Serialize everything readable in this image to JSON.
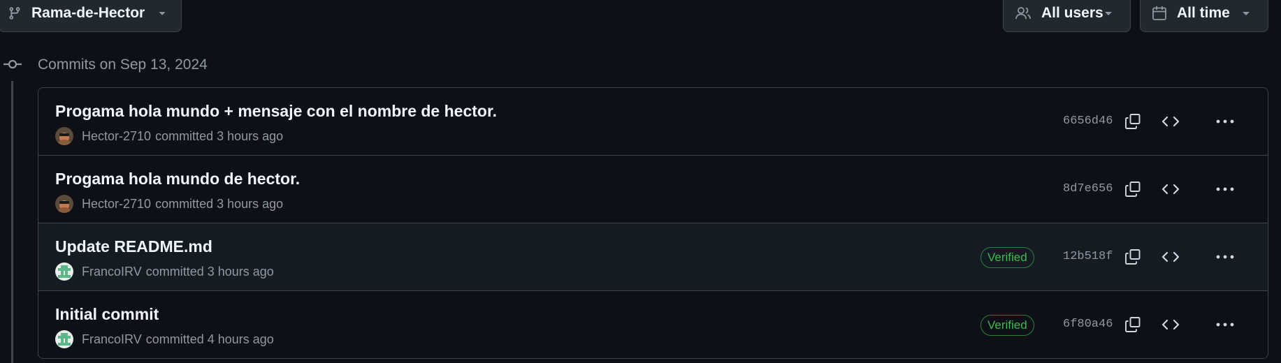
{
  "toolbar": {
    "branch_label": "Rama-de-Hector",
    "users_label": "All users",
    "time_label": "All time"
  },
  "group": {
    "date_label": "Commits on Sep 13, 2024"
  },
  "commits": [
    {
      "title": "Progama hola mundo + mensaje con el nombre de hector.",
      "author": "Hector-2710",
      "committed_text": "committed 3 hours ago",
      "verified": "",
      "sha": "6656d46"
    },
    {
      "title": "Progama hola mundo de hector.",
      "author": "Hector-2710",
      "committed_text": "committed 3 hours ago",
      "verified": "",
      "sha": "8d7e656"
    },
    {
      "title": "Update README.md",
      "author": "FrancoIRV",
      "committed_text": "committed 3 hours ago",
      "verified": "Verified",
      "sha": "12b518f"
    },
    {
      "title": "Initial commit",
      "author": "FrancoIRV",
      "committed_text": "committed 4 hours ago",
      "verified": "Verified",
      "sha": "6f80a46"
    }
  ],
  "colors": {
    "background": "#0d1117",
    "row_highlight": "#151b23",
    "border": "#3d444d",
    "verified_green": "#3fb950",
    "muted_text": "#9198a1"
  },
  "icons": {
    "branch": "git-branch-icon",
    "users": "people-icon",
    "calendar": "calendar-icon",
    "caret": "triangle-down-icon",
    "commit": "git-commit-icon",
    "copy": "copy-icon",
    "code": "code-icon",
    "more": "kebab-horizontal-icon"
  }
}
